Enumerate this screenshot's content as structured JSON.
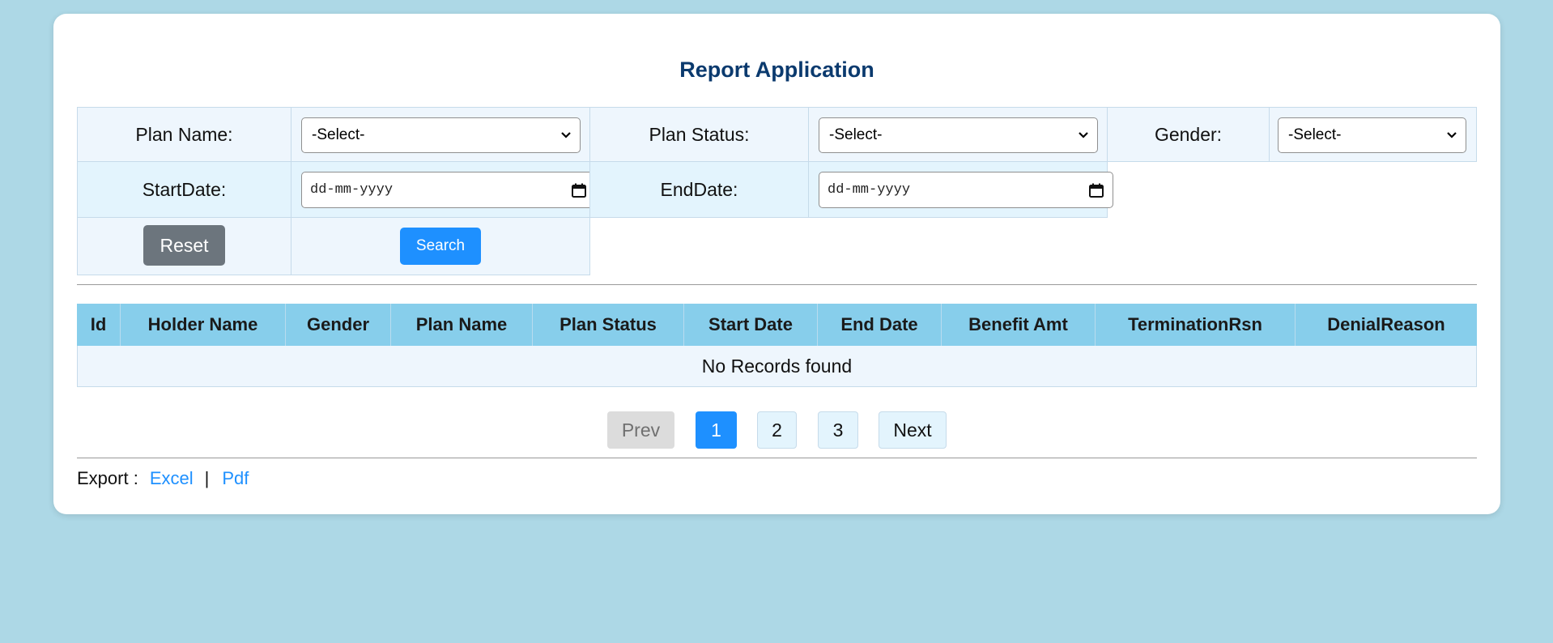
{
  "page": {
    "title": "Report Application"
  },
  "filters": {
    "plan_name_label": "Plan Name:",
    "plan_name_value": "-Select-",
    "plan_status_label": "Plan Status:",
    "plan_status_value": "-Select-",
    "gender_label": "Gender:",
    "gender_value": "-Select-",
    "start_date_label": "StartDate:",
    "start_date_placeholder": "dd-mm-yyyy",
    "end_date_label": "EndDate:",
    "end_date_placeholder": "dd-mm-yyyy",
    "reset_label": "Reset",
    "search_label": "Search"
  },
  "table": {
    "headers": [
      "Id",
      "Holder Name",
      "Gender",
      "Plan Name",
      "Plan Status",
      "Start Date",
      "End Date",
      "Benefit Amt",
      "TerminationRsn",
      "DenialReason"
    ],
    "empty_message": "No Records found"
  },
  "pagination": {
    "prev_label": "Prev",
    "pages": [
      "1",
      "2",
      "3"
    ],
    "active_page": "1",
    "next_label": "Next"
  },
  "export": {
    "label": "Export :",
    "excel_label": "Excel",
    "separator": "|",
    "pdf_label": "Pdf"
  },
  "colors": {
    "background": "#add8e6",
    "title": "#0b3a6e",
    "header_bg": "#87ceeb",
    "accent": "#1e90ff",
    "reset_button": "#6c757d"
  },
  "icons": {
    "select_arrow": "chevron-down-icon",
    "date_picker": "calendar-icon"
  }
}
